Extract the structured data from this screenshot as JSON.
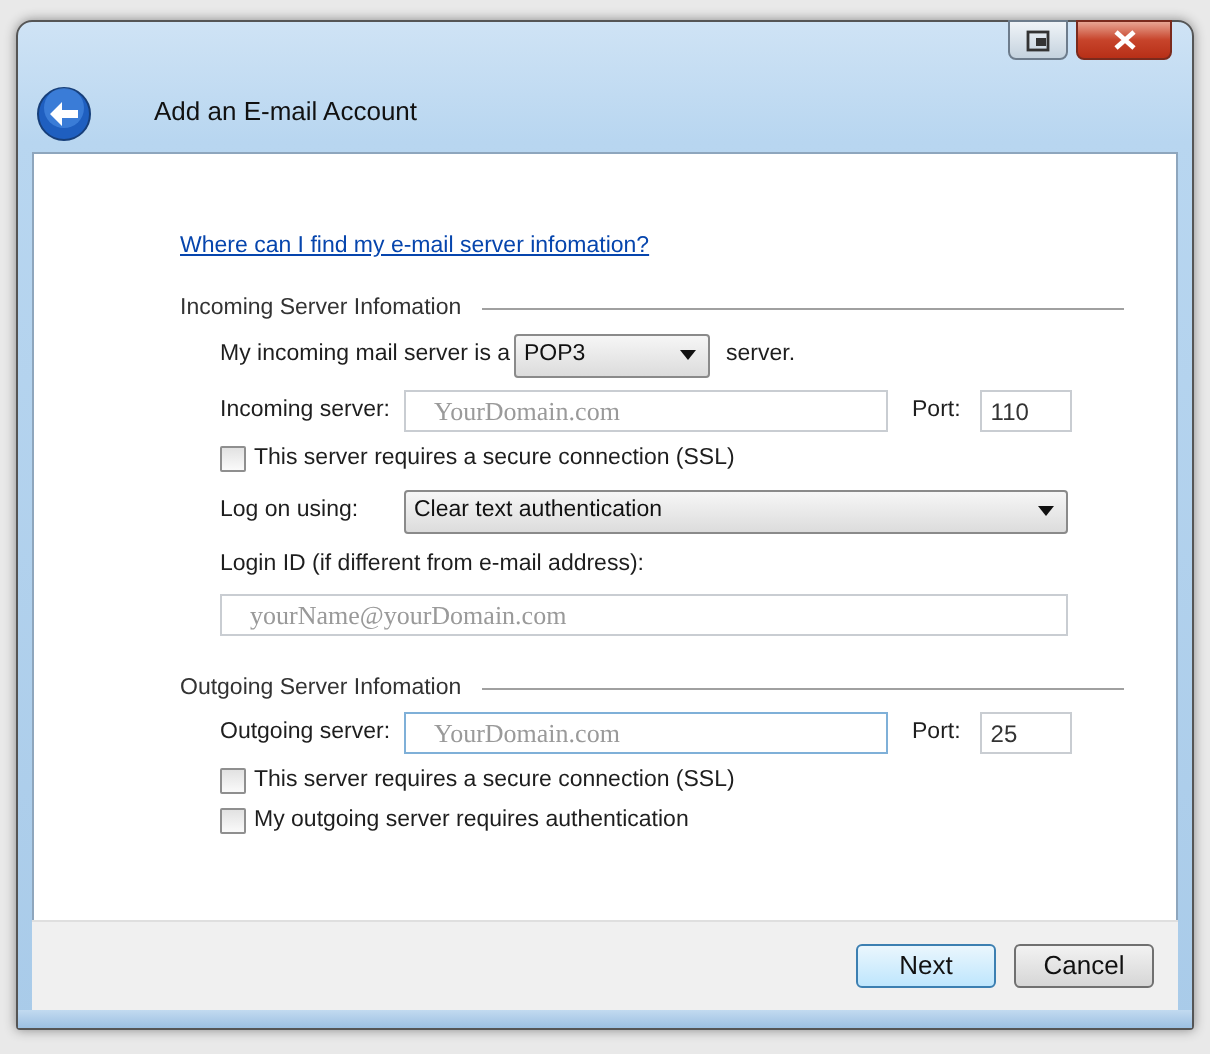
{
  "window": {
    "title": "Add an E-mail Account"
  },
  "help_link": "Where can I find my e-mail server infomation?",
  "sections": [
    {
      "title": "Incoming Server Infomation",
      "rows": [
        {
          "kind": "type",
          "label": "My incoming mail server is a",
          "value": "POP3",
          "suffix": "server."
        },
        {
          "kind": "server",
          "label": "Incoming server:",
          "placeholder": "YourDomain.com",
          "focused": false,
          "port_label": "Port:",
          "port": "110"
        },
        {
          "kind": "checkbox",
          "label": "This server requires a secure connection (SSL)",
          "checked": false
        },
        {
          "kind": "dropdown",
          "label": "Log on using:",
          "value": "Clear text authentication"
        },
        {
          "kind": "caption",
          "label": "Login ID (if different from e-mail address):"
        },
        {
          "kind": "field",
          "placeholder": "yourName@yourDomain.com"
        }
      ]
    },
    {
      "title": "Outgoing Server Infomation",
      "rows": [
        {
          "kind": "server",
          "label": "Outgoing server:",
          "placeholder": "YourDomain.com",
          "focused": true,
          "port_label": "Port:",
          "port": "25"
        },
        {
          "kind": "checkbox",
          "label": "This server requires a secure connection (SSL)",
          "checked": false
        },
        {
          "kind": "checkbox",
          "label": "My outgoing server requires authentication",
          "checked": false
        }
      ]
    }
  ],
  "buttons": [
    {
      "label": "Next",
      "default": true
    },
    {
      "label": "Cancel",
      "default": false
    }
  ]
}
